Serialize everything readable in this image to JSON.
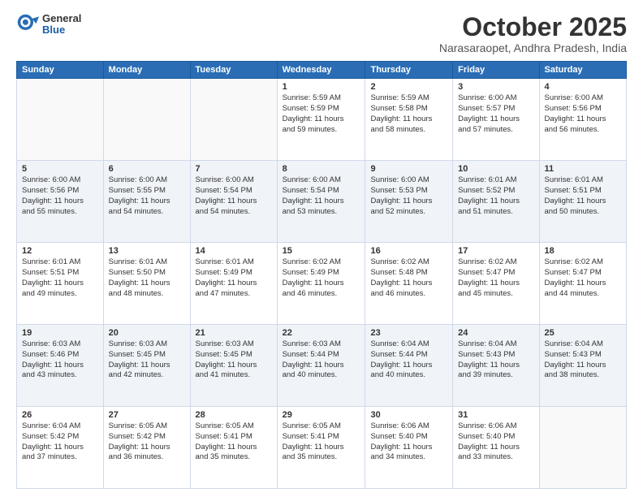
{
  "logo": {
    "general": "General",
    "blue": "Blue"
  },
  "title": "October 2025",
  "location": "Narasaraopet, Andhra Pradesh, India",
  "header_days": [
    "Sunday",
    "Monday",
    "Tuesday",
    "Wednesday",
    "Thursday",
    "Friday",
    "Saturday"
  ],
  "weeks": [
    [
      {
        "day": "",
        "info": ""
      },
      {
        "day": "",
        "info": ""
      },
      {
        "day": "",
        "info": ""
      },
      {
        "day": "1",
        "info": "Sunrise: 5:59 AM\nSunset: 5:59 PM\nDaylight: 11 hours\nand 59 minutes."
      },
      {
        "day": "2",
        "info": "Sunrise: 5:59 AM\nSunset: 5:58 PM\nDaylight: 11 hours\nand 58 minutes."
      },
      {
        "day": "3",
        "info": "Sunrise: 6:00 AM\nSunset: 5:57 PM\nDaylight: 11 hours\nand 57 minutes."
      },
      {
        "day": "4",
        "info": "Sunrise: 6:00 AM\nSunset: 5:56 PM\nDaylight: 11 hours\nand 56 minutes."
      }
    ],
    [
      {
        "day": "5",
        "info": "Sunrise: 6:00 AM\nSunset: 5:56 PM\nDaylight: 11 hours\nand 55 minutes."
      },
      {
        "day": "6",
        "info": "Sunrise: 6:00 AM\nSunset: 5:55 PM\nDaylight: 11 hours\nand 54 minutes."
      },
      {
        "day": "7",
        "info": "Sunrise: 6:00 AM\nSunset: 5:54 PM\nDaylight: 11 hours\nand 54 minutes."
      },
      {
        "day": "8",
        "info": "Sunrise: 6:00 AM\nSunset: 5:54 PM\nDaylight: 11 hours\nand 53 minutes."
      },
      {
        "day": "9",
        "info": "Sunrise: 6:00 AM\nSunset: 5:53 PM\nDaylight: 11 hours\nand 52 minutes."
      },
      {
        "day": "10",
        "info": "Sunrise: 6:01 AM\nSunset: 5:52 PM\nDaylight: 11 hours\nand 51 minutes."
      },
      {
        "day": "11",
        "info": "Sunrise: 6:01 AM\nSunset: 5:51 PM\nDaylight: 11 hours\nand 50 minutes."
      }
    ],
    [
      {
        "day": "12",
        "info": "Sunrise: 6:01 AM\nSunset: 5:51 PM\nDaylight: 11 hours\nand 49 minutes."
      },
      {
        "day": "13",
        "info": "Sunrise: 6:01 AM\nSunset: 5:50 PM\nDaylight: 11 hours\nand 48 minutes."
      },
      {
        "day": "14",
        "info": "Sunrise: 6:01 AM\nSunset: 5:49 PM\nDaylight: 11 hours\nand 47 minutes."
      },
      {
        "day": "15",
        "info": "Sunrise: 6:02 AM\nSunset: 5:49 PM\nDaylight: 11 hours\nand 46 minutes."
      },
      {
        "day": "16",
        "info": "Sunrise: 6:02 AM\nSunset: 5:48 PM\nDaylight: 11 hours\nand 46 minutes."
      },
      {
        "day": "17",
        "info": "Sunrise: 6:02 AM\nSunset: 5:47 PM\nDaylight: 11 hours\nand 45 minutes."
      },
      {
        "day": "18",
        "info": "Sunrise: 6:02 AM\nSunset: 5:47 PM\nDaylight: 11 hours\nand 44 minutes."
      }
    ],
    [
      {
        "day": "19",
        "info": "Sunrise: 6:03 AM\nSunset: 5:46 PM\nDaylight: 11 hours\nand 43 minutes."
      },
      {
        "day": "20",
        "info": "Sunrise: 6:03 AM\nSunset: 5:45 PM\nDaylight: 11 hours\nand 42 minutes."
      },
      {
        "day": "21",
        "info": "Sunrise: 6:03 AM\nSunset: 5:45 PM\nDaylight: 11 hours\nand 41 minutes."
      },
      {
        "day": "22",
        "info": "Sunrise: 6:03 AM\nSunset: 5:44 PM\nDaylight: 11 hours\nand 40 minutes."
      },
      {
        "day": "23",
        "info": "Sunrise: 6:04 AM\nSunset: 5:44 PM\nDaylight: 11 hours\nand 40 minutes."
      },
      {
        "day": "24",
        "info": "Sunrise: 6:04 AM\nSunset: 5:43 PM\nDaylight: 11 hours\nand 39 minutes."
      },
      {
        "day": "25",
        "info": "Sunrise: 6:04 AM\nSunset: 5:43 PM\nDaylight: 11 hours\nand 38 minutes."
      }
    ],
    [
      {
        "day": "26",
        "info": "Sunrise: 6:04 AM\nSunset: 5:42 PM\nDaylight: 11 hours\nand 37 minutes."
      },
      {
        "day": "27",
        "info": "Sunrise: 6:05 AM\nSunset: 5:42 PM\nDaylight: 11 hours\nand 36 minutes."
      },
      {
        "day": "28",
        "info": "Sunrise: 6:05 AM\nSunset: 5:41 PM\nDaylight: 11 hours\nand 35 minutes."
      },
      {
        "day": "29",
        "info": "Sunrise: 6:05 AM\nSunset: 5:41 PM\nDaylight: 11 hours\nand 35 minutes."
      },
      {
        "day": "30",
        "info": "Sunrise: 6:06 AM\nSunset: 5:40 PM\nDaylight: 11 hours\nand 34 minutes."
      },
      {
        "day": "31",
        "info": "Sunrise: 6:06 AM\nSunset: 5:40 PM\nDaylight: 11 hours\nand 33 minutes."
      },
      {
        "day": "",
        "info": ""
      }
    ]
  ]
}
